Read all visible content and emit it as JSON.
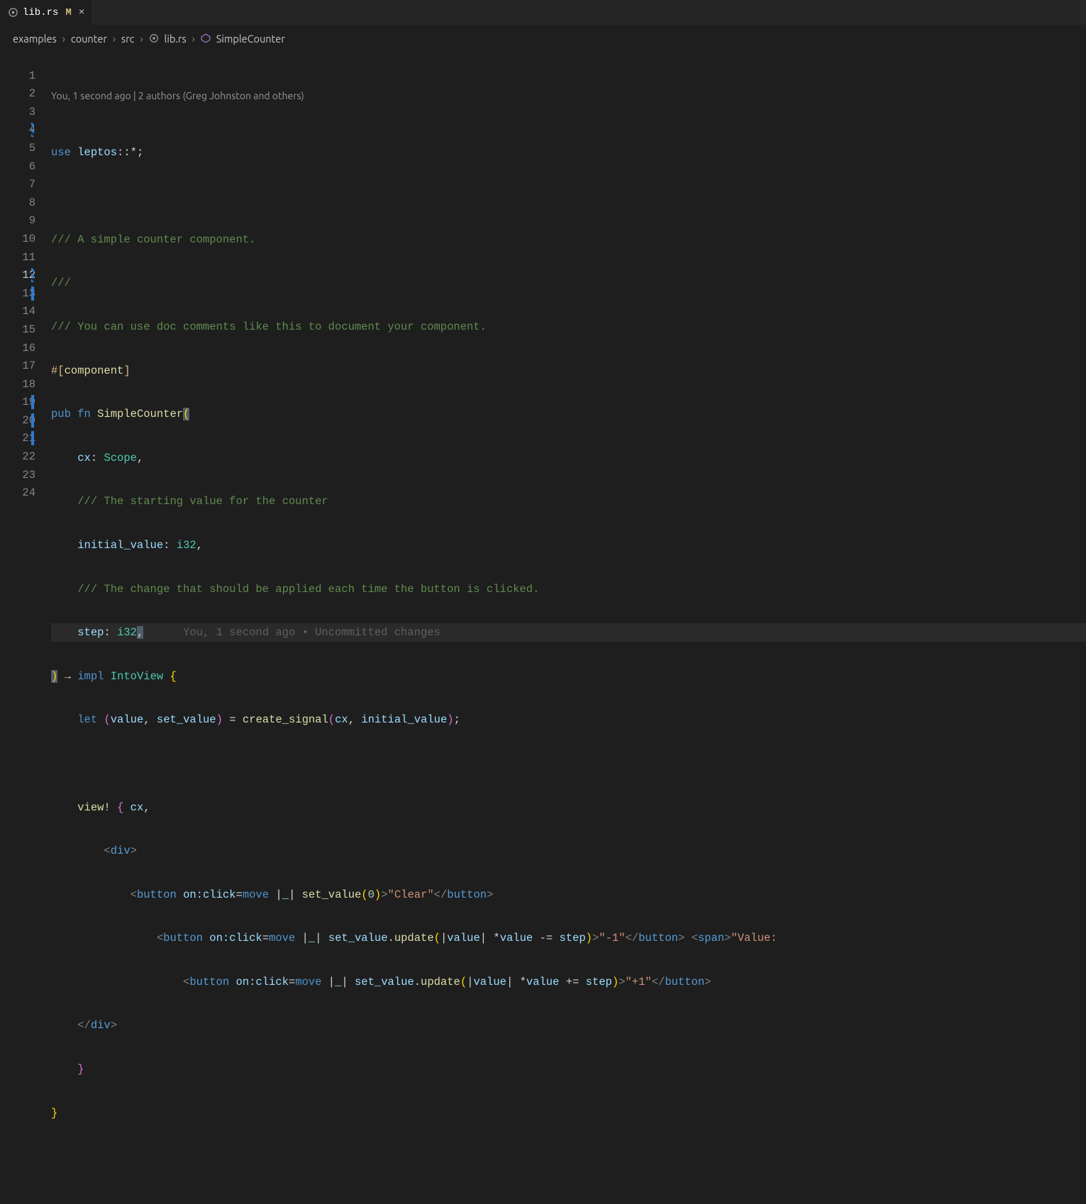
{
  "tab": {
    "filename": "lib.rs",
    "modified_marker": "M",
    "close_glyph": "×"
  },
  "breadcrumbs": {
    "items": [
      "examples",
      "counter",
      "src",
      "lib.rs",
      "SimpleCounter"
    ]
  },
  "codelens": "You, 1 second ago | 2 authors (Greg Johnston and others)",
  "blame_line12": "You, 1 second ago • Uncommitted changes",
  "line_count": 24,
  "current_line": 12,
  "code": {
    "l1": {
      "use": "use",
      "path": "leptos",
      "sep": "::",
      "star": "*",
      "semi": ";"
    },
    "l3": "/// A simple counter component.",
    "l4": "///",
    "l5": "/// You can use doc comments like this to document your component.",
    "l6": {
      "hash": "#[",
      "name": "component",
      "close": "]"
    },
    "l7": {
      "pub": "pub",
      "fn": "fn",
      "name": "SimpleCounter",
      "open": "("
    },
    "l8": {
      "arg": "cx",
      "colon": ":",
      "type": "Scope",
      "comma": ","
    },
    "l9": "/// The starting value for the counter",
    "l10": {
      "arg": "initial_value",
      "colon": ":",
      "type": "i32",
      "comma": ","
    },
    "l11": "/// The change that should be applied each time the button is clicked.",
    "l12": {
      "arg": "step",
      "colon": ":",
      "type": "i32",
      "comma": ","
    },
    "l13": {
      "close": ")",
      "arrow": "→",
      "impl": "impl",
      "trait": "IntoView",
      "brace": "{"
    },
    "l14": {
      "let": "let",
      "open": "(",
      "v1": "value",
      "comma1": ",",
      "v2": "set_value",
      "close": ")",
      "eq": "=",
      "fn": "create_signal",
      "p1": "(",
      "a1": "cx",
      "comma2": ",",
      "a2": "initial_value",
      "p2": ")",
      "semi": ";"
    },
    "l16": {
      "mac": "view!",
      "open": "{",
      "cx": "cx",
      "comma": ","
    },
    "l17": {
      "open": "<",
      "tag": "div",
      "close": ">"
    },
    "l18": {
      "open": "<",
      "tag": "button",
      "attr": "on:click",
      "eq": "=",
      "move": "move",
      "bar": "|",
      "us": "_",
      "bar2": "|",
      "fn": "set_value",
      "p1": "(",
      "num": "0",
      "p2": ")",
      "gt": ">",
      "text": "\"Clear\"",
      "lt": "</",
      "tag2": "button",
      "gt2": ">"
    },
    "l19": {
      "open": "<",
      "tag": "button",
      "attr": "on:click",
      "eq": "=",
      "move": "move",
      "bar": "|",
      "us": "_",
      "bar2": "|",
      "obj": "set_value",
      "dot": ".",
      "method": "update",
      "p1": "(",
      "bar3": "|",
      "v": "value",
      "bar4": "|",
      "star": "*",
      "v2": "value",
      "op": "-=",
      "step": "step",
      "p2": ")",
      "gt": ">",
      "text": "\"-1\"",
      "lt": "</",
      "tag2": "button",
      "gt2": ">",
      "sp": "<",
      "span": "span",
      "spgt": ">",
      "sptxt": "\"Value:"
    },
    "l20": {
      "open": "<",
      "tag": "button",
      "attr": "on:click",
      "eq": "=",
      "move": "move",
      "bar": "|",
      "us": "_",
      "bar2": "|",
      "obj": "set_value",
      "dot": ".",
      "method": "update",
      "p1": "(",
      "bar3": "|",
      "v": "value",
      "bar4": "|",
      "star": "*",
      "v2": "value",
      "op": "+=",
      "step": "step",
      "p2": ")",
      "gt": ">",
      "text": "\"+1\"",
      "lt": "</",
      "tag2": "button",
      "gt2": ">"
    },
    "l21": {
      "lt": "</",
      "tag": "div",
      "gt": ">"
    },
    "l22": "}",
    "l23": "}"
  }
}
